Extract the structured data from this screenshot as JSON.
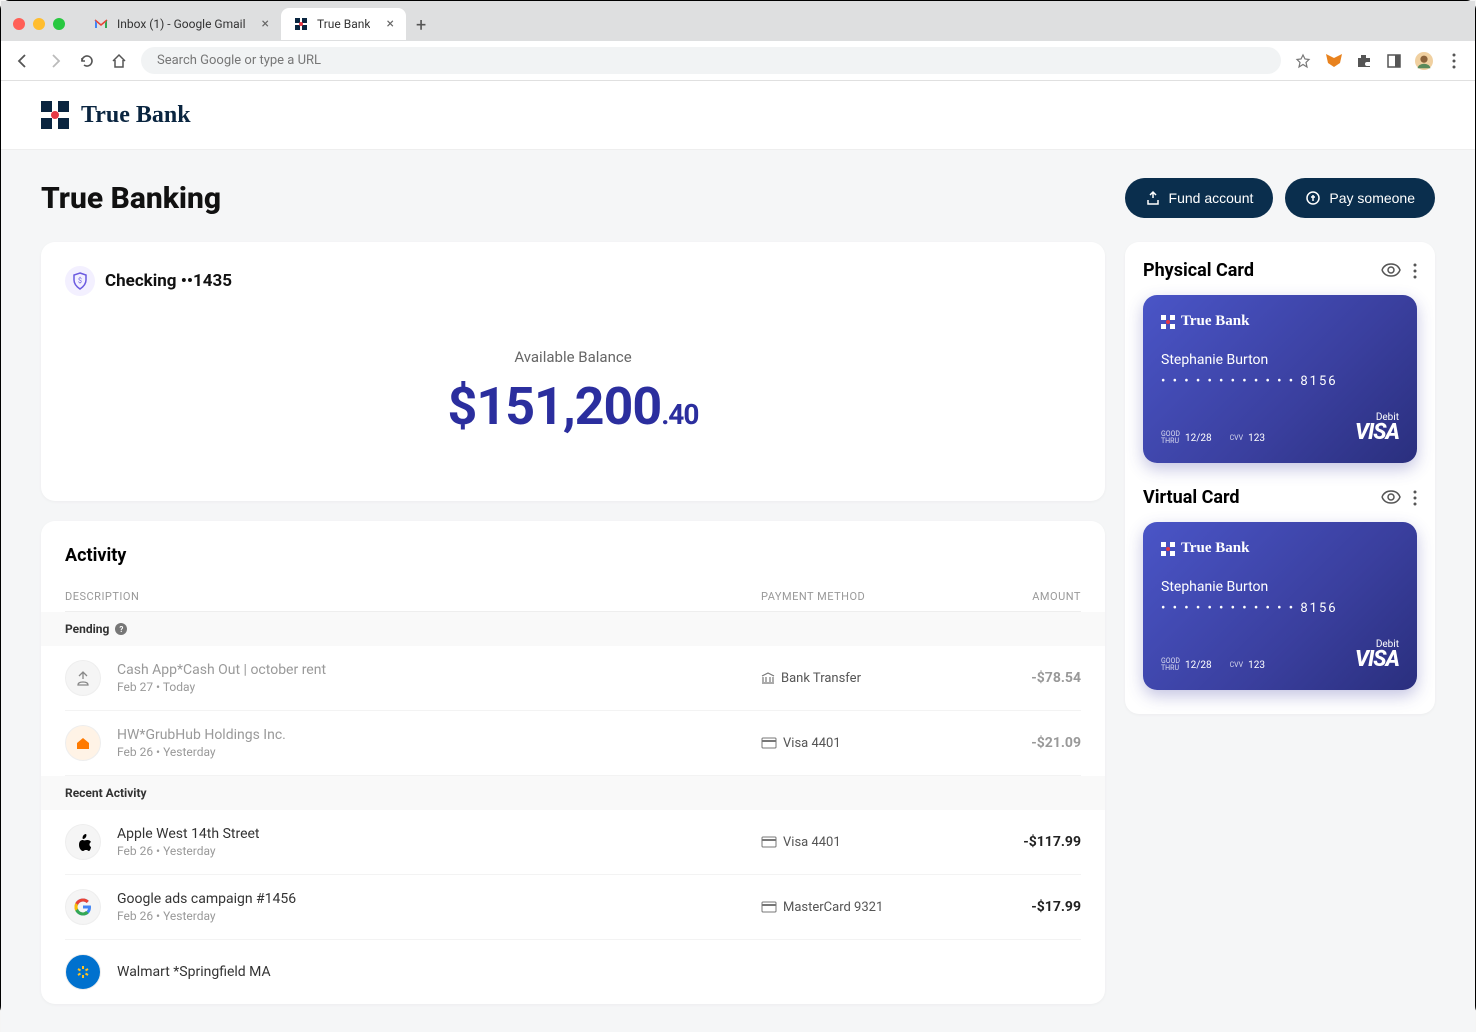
{
  "browser": {
    "tabs": [
      {
        "title": "Inbox (1) - Google Gmail",
        "active": false
      },
      {
        "title": "True Bank",
        "active": true
      }
    ],
    "url_placeholder": "Search Google or type a URL"
  },
  "brand": {
    "name": "True Bank"
  },
  "page": {
    "title": "True Banking",
    "fund_btn": "Fund account",
    "pay_btn": "Pay someone"
  },
  "account": {
    "name": "Checking ••1435",
    "balance_label": "Available Balance",
    "balance_main": "$151,200",
    "balance_cents": ".40"
  },
  "activity": {
    "title": "Activity",
    "cols": {
      "desc": "DESCRIPTION",
      "pay": "PAYMENT METHOD",
      "amt": "AMOUNT"
    },
    "pending_label": "Pending",
    "recent_label": "Recent Activity",
    "pending": [
      {
        "name": "Cash App*Cash Out | october rent",
        "date": "Feb 27 • Today",
        "method": "Bank Transfer",
        "method_type": "bank",
        "amount": "-$78.54",
        "icon_color": "#888"
      },
      {
        "name": "HW*GrubHub Holdings Inc.",
        "date": "Feb 26 • Yesterday",
        "method": "Visa 4401",
        "method_type": "card",
        "amount": "-$21.09",
        "icon_color": "#ff7a00"
      }
    ],
    "recent": [
      {
        "name": "Apple West 14th Street",
        "date": "Feb 26 • Yesterday",
        "method": "Visa 4401",
        "method_type": "card",
        "amount": "-$117.99",
        "icon": "apple"
      },
      {
        "name": "Google ads campaign #1456",
        "date": "Feb 26 • Yesterday",
        "method": "MasterCard 9321",
        "method_type": "card",
        "amount": "-$17.99",
        "icon": "google"
      }
    ],
    "partial": "Walmart *Springfield MA"
  },
  "cards": {
    "physical": {
      "title": "Physical Card",
      "holder": "Stephanie Burton",
      "number": "• • • •   • • • •   • • • •   8156",
      "good_thru_label": "GOOD\nTHRU",
      "good_thru": "12/28",
      "cvv_label": "CVV",
      "cvv": "123",
      "type": "Debit",
      "network": "VISA",
      "brand": "True Bank"
    },
    "virtual": {
      "title": "Virtual Card",
      "holder": "Stephanie Burton",
      "number": "• • • •   • • • •   • • • •   8156",
      "good_thru_label": "GOOD\nTHRU",
      "good_thru": "12/28",
      "cvv_label": "CVV",
      "cvv": "123",
      "type": "Debit",
      "network": "VISA",
      "brand": "True Bank"
    }
  }
}
